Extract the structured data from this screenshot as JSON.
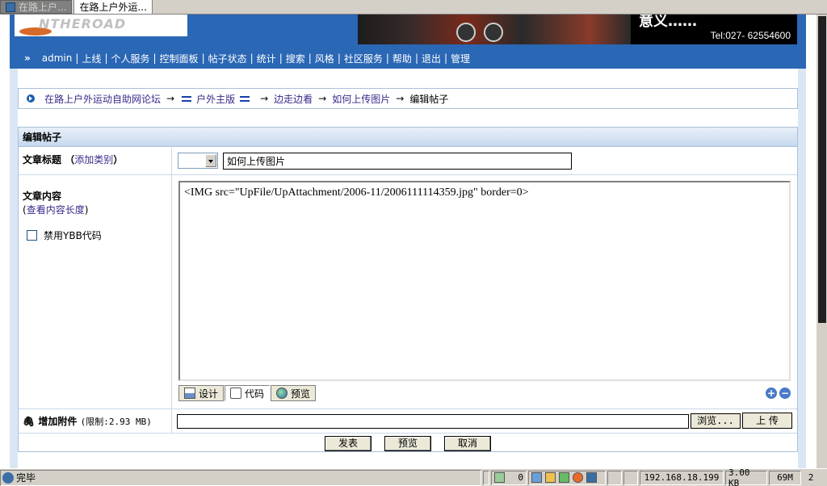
{
  "browser": {
    "tabs": [
      {
        "label": "在路上户..."
      },
      {
        "label": "在路上户外运..."
      }
    ]
  },
  "header": {
    "logo_text": "NTHEROAD",
    "banner_big_text": "意义……",
    "tel": "Tel:027- 62554600"
  },
  "nav": {
    "marker": "»",
    "items": [
      {
        "label": "admin"
      },
      {
        "label": "上线"
      },
      {
        "label": "个人服务"
      },
      {
        "label": "控制面板"
      },
      {
        "label": "帖子状态"
      },
      {
        "label": "统计"
      },
      {
        "label": "搜索"
      },
      {
        "label": "风格"
      },
      {
        "label": "社区服务"
      },
      {
        "label": "帮助"
      },
      {
        "label": "退出"
      },
      {
        "label": "管理"
      }
    ],
    "separator": "|"
  },
  "breadcrumb": {
    "items": [
      {
        "label": "在路上户外运动自助网论坛"
      },
      {
        "label": "户外主版"
      },
      {
        "label": "边走边看"
      },
      {
        "label": "如何上传图片"
      }
    ],
    "current": "编辑帖子",
    "arrow": "→"
  },
  "edit": {
    "title": "编辑帖子",
    "title_label": "文章标题",
    "add_category": "添加类别",
    "title_value": "如何上传图片",
    "content_label": "文章内容",
    "view_length": "查看内容长度",
    "disable_ybb": "禁用YBB代码",
    "content_value": "<IMG src=\"UpFile/UpAttachment/2006-11/2006111114359.jpg\" border=0>",
    "editor_tabs": [
      {
        "label": "设计"
      },
      {
        "label": "代码"
      },
      {
        "label": "预览"
      }
    ],
    "attach_label": "增加附件",
    "attach_limit": "(限制:2.93 MB)",
    "browse_label": "浏览...",
    "upload_label": "上 传",
    "submit_label": "发表",
    "preview_label": "预览",
    "cancel_label": "取消"
  },
  "statusbar": {
    "done": "完毕",
    "count": "0",
    "ip": "192.168.18.199",
    "size": "3.00 KB",
    "mem": "69M",
    "num": "2"
  }
}
